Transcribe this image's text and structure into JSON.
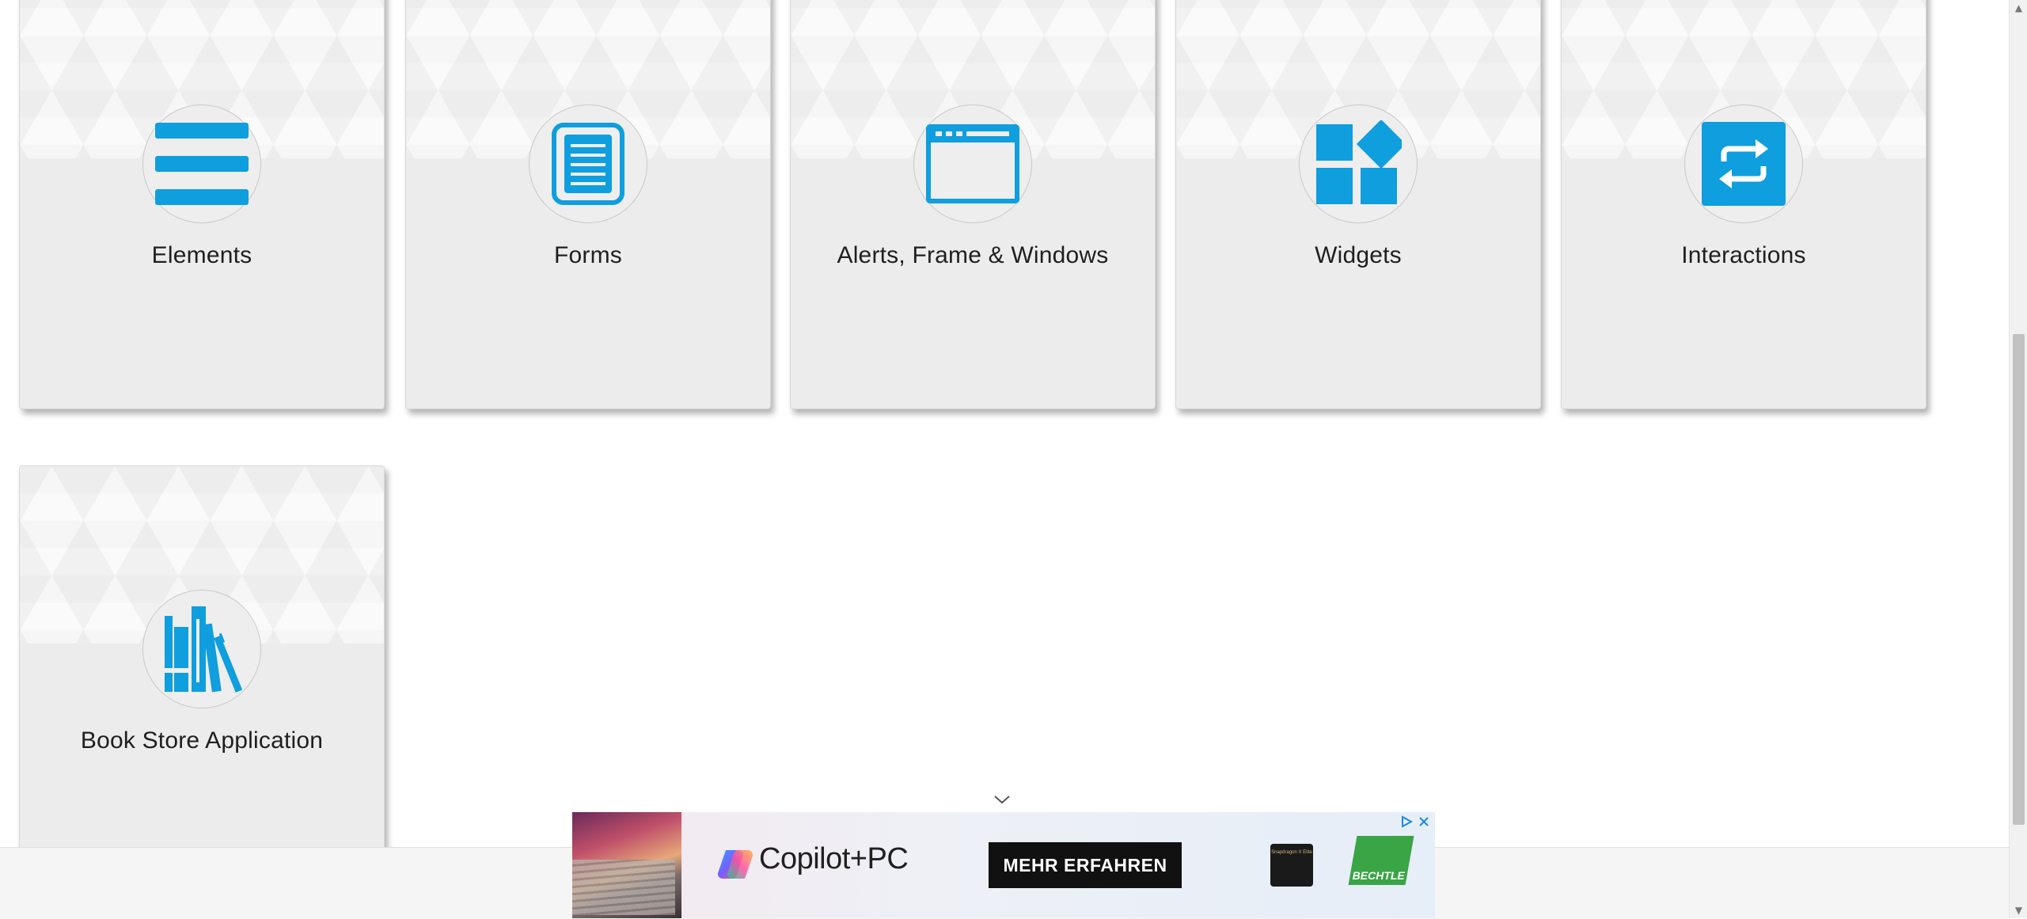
{
  "cards": [
    {
      "id": "elements",
      "title": "Elements",
      "icon": "hamburger-lines-icon"
    },
    {
      "id": "forms",
      "title": "Forms",
      "icon": "document-icon"
    },
    {
      "id": "alerts",
      "title": "Alerts, Frame & Windows",
      "icon": "browser-window-icon"
    },
    {
      "id": "widgets",
      "title": "Widgets",
      "icon": "widgets-blocks-icon"
    },
    {
      "id": "interactions",
      "title": "Interactions",
      "icon": "repeat-arrows-icon"
    },
    {
      "id": "bookstore",
      "title": "Book Store Application",
      "icon": "books-icon"
    }
  ],
  "ad": {
    "brand": "Copilot+PC",
    "cta": "MEHR ERFAHREN",
    "chip_text": "Snapdragon X Elite",
    "partner": "BECHTLE"
  },
  "colors": {
    "accent": "#0f9ede",
    "card_bg": "#ececec",
    "title_text": "#1f1f1f"
  }
}
